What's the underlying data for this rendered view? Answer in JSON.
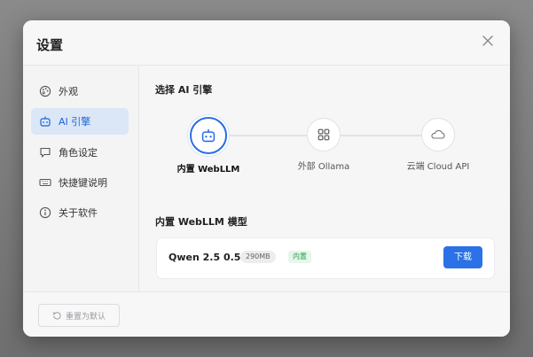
{
  "dialog": {
    "title": "设置"
  },
  "sidebar": {
    "items": [
      {
        "label": "外观",
        "icon": "palette-icon"
      },
      {
        "label": "AI 引擎",
        "icon": "robot-icon",
        "active": true
      },
      {
        "label": "角色设定",
        "icon": "chat-bubble-icon"
      },
      {
        "label": "快捷键说明",
        "icon": "keyboard-icon"
      },
      {
        "label": "关于软件",
        "icon": "info-icon"
      }
    ]
  },
  "engine_section": {
    "title": "选择 AI 引擎",
    "engines": [
      {
        "label": "内置 WebLLM",
        "icon": "robot-icon",
        "active": true
      },
      {
        "label": "外部 Ollama",
        "icon": "grid-icon"
      },
      {
        "label": "云端 Cloud API",
        "icon": "cloud-icon"
      }
    ]
  },
  "model_section": {
    "title": "内置 WebLLM 模型",
    "model_name": "Qwen 2.5 0.5B",
    "size_badge": "290MB",
    "builtin_badge": "内置",
    "download_label": "下载"
  },
  "footer": {
    "reset_label": "重置为默认"
  },
  "colors": {
    "accent": "#2a72e6",
    "active_bg": "#dbe7f7",
    "badge_green": "#2a9e4d"
  }
}
